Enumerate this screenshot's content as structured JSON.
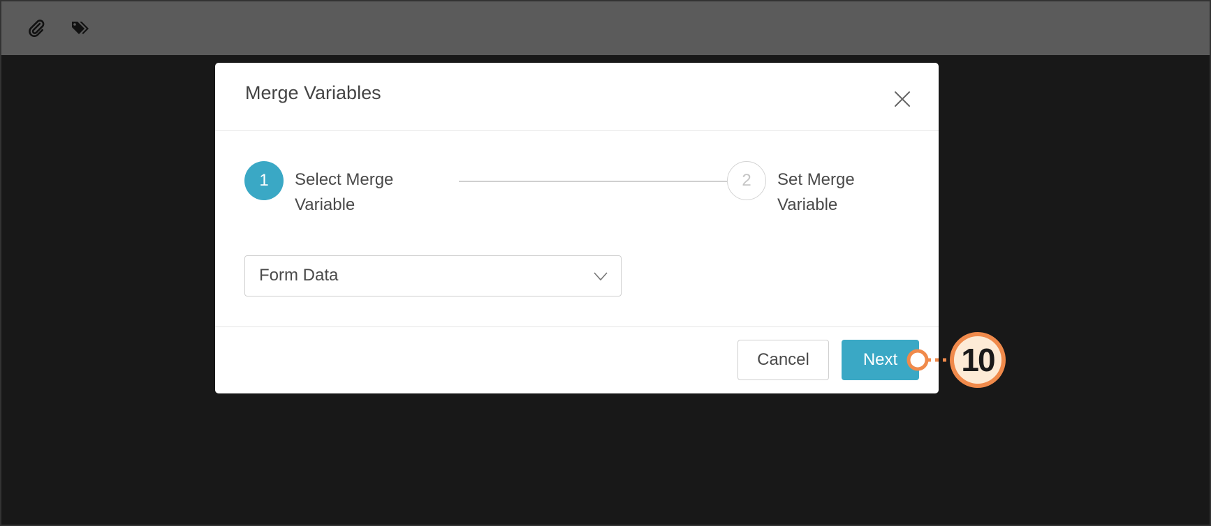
{
  "toolbar": {
    "icons": [
      "paperclip-icon",
      "tags-icon"
    ]
  },
  "modal": {
    "title": "Merge Variables",
    "close_icon": "close-icon",
    "steps": [
      {
        "number": "1",
        "label_line1": "Select Merge",
        "label_line2": "Variable",
        "state": "active"
      },
      {
        "number": "2",
        "label_line1": "Set Merge",
        "label_line2": "Variable",
        "state": "inactive"
      }
    ],
    "select": {
      "value": "Form Data",
      "icon": "chevron-down-icon"
    },
    "footer": {
      "cancel_label": "Cancel",
      "next_label": "Next"
    }
  },
  "callout": {
    "number": "10"
  },
  "colors": {
    "accent": "#3aa8c5",
    "callout": "#f08a4b",
    "callout_fill": "#fdebd6",
    "toolbar_bg": "#5b5b5b",
    "overlay_bg": "#181818"
  }
}
